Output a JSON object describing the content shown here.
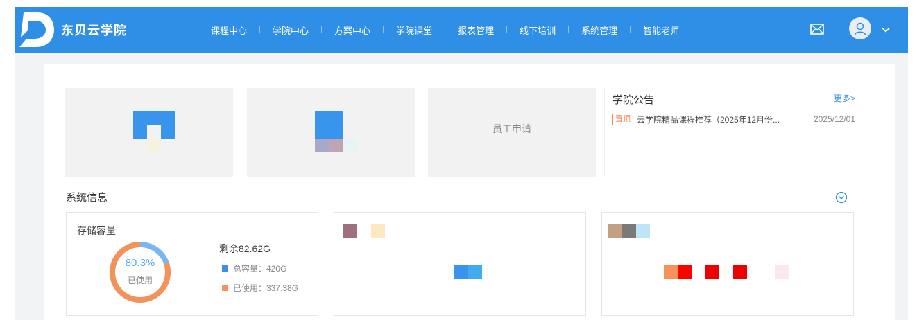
{
  "header": {
    "brand": "东贝云学院",
    "nav": [
      "课程中心",
      "学院中心",
      "方案中心",
      "学院课堂",
      "报表管理",
      "线下培训",
      "系统管理",
      "智能老师"
    ],
    "icons": {
      "logo": "logo-icon",
      "mail": "mail-icon",
      "avatar": "user-avatar-icon",
      "caret": "chevron-down-icon"
    },
    "color": "#2f8fe6"
  },
  "tiles": [
    {
      "label": ""
    },
    {
      "label": ""
    },
    {
      "label": "员工申请"
    }
  ],
  "notice": {
    "title": "学院公告",
    "more": "更多>",
    "items": [
      {
        "tag": "置顶",
        "text": "云学院精品课程推荐（2025年12月份...",
        "date": "2025/12/01"
      }
    ]
  },
  "system": {
    "title": "系统信息",
    "toggle_icon": "chevron-circle-down-icon",
    "storage": {
      "title": "存储容量",
      "percent": "80.3%",
      "used_fraction": 0.803,
      "status": "已使用",
      "remaining": "剩余82.62G",
      "total_label": "总容量：420G",
      "used_label": "已使用：337.38G",
      "colors": {
        "total": "#3d8ee8",
        "used": "#f4925a"
      }
    }
  }
}
